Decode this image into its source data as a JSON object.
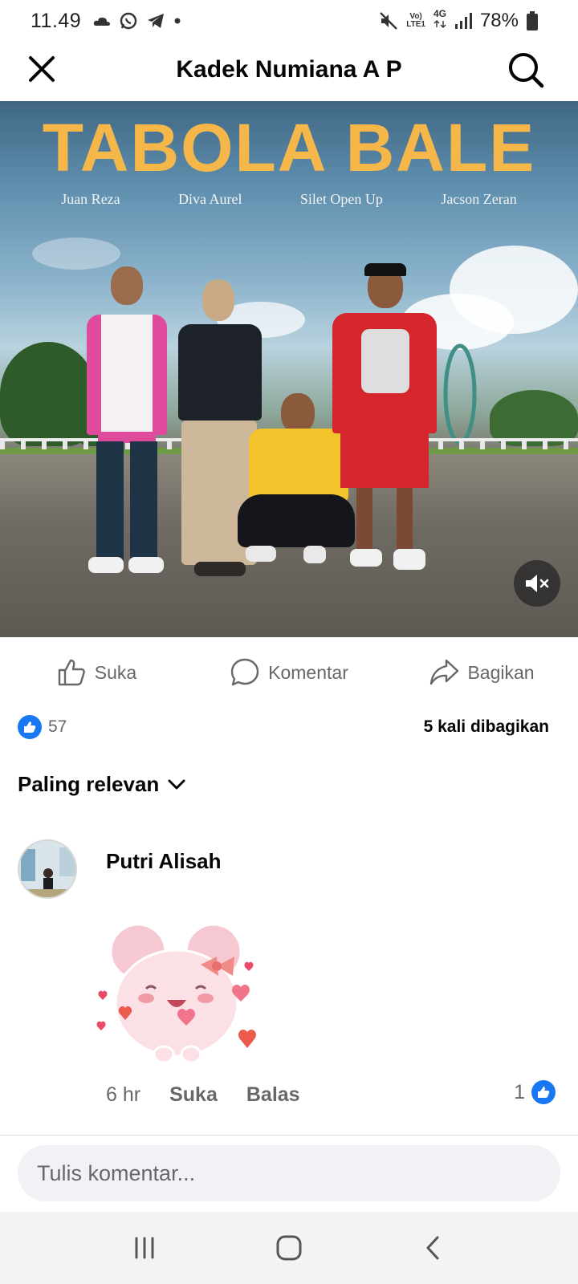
{
  "status_bar": {
    "time": "11.49",
    "network_top": "Vo)",
    "network_bottom": "LTE1",
    "net_type": "4G",
    "battery": "78%"
  },
  "header": {
    "title": "Kadek Numiana A P"
  },
  "media": {
    "title": "TABOLA BALE",
    "artists": [
      "Juan Reza",
      "Diva Aurel",
      "Silet Open Up",
      "Jacson Zeran"
    ]
  },
  "actions": {
    "like": "Suka",
    "comment": "Komentar",
    "share": "Bagikan"
  },
  "stats": {
    "likes": "57",
    "shares": "5 kali dibagikan"
  },
  "sort": {
    "label": "Paling relevan"
  },
  "comment": {
    "author": "Putri Alisah",
    "time": "6 hr",
    "like_label": "Suka",
    "reply_label": "Balas",
    "like_count": "1"
  },
  "composer": {
    "placeholder": "Tulis komentar..."
  },
  "colors": {
    "accent": "#1877f2",
    "title_yellow": "#f5b64a",
    "secondary_text": "#65676b"
  }
}
